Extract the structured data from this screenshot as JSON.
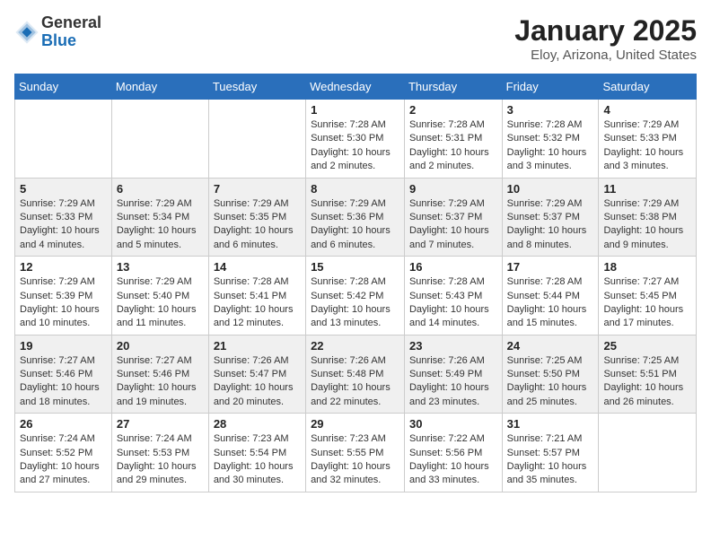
{
  "logo": {
    "general": "General",
    "blue": "Blue"
  },
  "title": "January 2025",
  "subtitle": "Eloy, Arizona, United States",
  "headers": [
    "Sunday",
    "Monday",
    "Tuesday",
    "Wednesday",
    "Thursday",
    "Friday",
    "Saturday"
  ],
  "weeks": [
    [
      {
        "num": "",
        "info": ""
      },
      {
        "num": "",
        "info": ""
      },
      {
        "num": "",
        "info": ""
      },
      {
        "num": "1",
        "info": "Sunrise: 7:28 AM\nSunset: 5:30 PM\nDaylight: 10 hours\nand 2 minutes."
      },
      {
        "num": "2",
        "info": "Sunrise: 7:28 AM\nSunset: 5:31 PM\nDaylight: 10 hours\nand 2 minutes."
      },
      {
        "num": "3",
        "info": "Sunrise: 7:28 AM\nSunset: 5:32 PM\nDaylight: 10 hours\nand 3 minutes."
      },
      {
        "num": "4",
        "info": "Sunrise: 7:29 AM\nSunset: 5:33 PM\nDaylight: 10 hours\nand 3 minutes."
      }
    ],
    [
      {
        "num": "5",
        "info": "Sunrise: 7:29 AM\nSunset: 5:33 PM\nDaylight: 10 hours\nand 4 minutes."
      },
      {
        "num": "6",
        "info": "Sunrise: 7:29 AM\nSunset: 5:34 PM\nDaylight: 10 hours\nand 5 minutes."
      },
      {
        "num": "7",
        "info": "Sunrise: 7:29 AM\nSunset: 5:35 PM\nDaylight: 10 hours\nand 6 minutes."
      },
      {
        "num": "8",
        "info": "Sunrise: 7:29 AM\nSunset: 5:36 PM\nDaylight: 10 hours\nand 6 minutes."
      },
      {
        "num": "9",
        "info": "Sunrise: 7:29 AM\nSunset: 5:37 PM\nDaylight: 10 hours\nand 7 minutes."
      },
      {
        "num": "10",
        "info": "Sunrise: 7:29 AM\nSunset: 5:37 PM\nDaylight: 10 hours\nand 8 minutes."
      },
      {
        "num": "11",
        "info": "Sunrise: 7:29 AM\nSunset: 5:38 PM\nDaylight: 10 hours\nand 9 minutes."
      }
    ],
    [
      {
        "num": "12",
        "info": "Sunrise: 7:29 AM\nSunset: 5:39 PM\nDaylight: 10 hours\nand 10 minutes."
      },
      {
        "num": "13",
        "info": "Sunrise: 7:29 AM\nSunset: 5:40 PM\nDaylight: 10 hours\nand 11 minutes."
      },
      {
        "num": "14",
        "info": "Sunrise: 7:28 AM\nSunset: 5:41 PM\nDaylight: 10 hours\nand 12 minutes."
      },
      {
        "num": "15",
        "info": "Sunrise: 7:28 AM\nSunset: 5:42 PM\nDaylight: 10 hours\nand 13 minutes."
      },
      {
        "num": "16",
        "info": "Sunrise: 7:28 AM\nSunset: 5:43 PM\nDaylight: 10 hours\nand 14 minutes."
      },
      {
        "num": "17",
        "info": "Sunrise: 7:28 AM\nSunset: 5:44 PM\nDaylight: 10 hours\nand 15 minutes."
      },
      {
        "num": "18",
        "info": "Sunrise: 7:27 AM\nSunset: 5:45 PM\nDaylight: 10 hours\nand 17 minutes."
      }
    ],
    [
      {
        "num": "19",
        "info": "Sunrise: 7:27 AM\nSunset: 5:46 PM\nDaylight: 10 hours\nand 18 minutes."
      },
      {
        "num": "20",
        "info": "Sunrise: 7:27 AM\nSunset: 5:46 PM\nDaylight: 10 hours\nand 19 minutes."
      },
      {
        "num": "21",
        "info": "Sunrise: 7:26 AM\nSunset: 5:47 PM\nDaylight: 10 hours\nand 20 minutes."
      },
      {
        "num": "22",
        "info": "Sunrise: 7:26 AM\nSunset: 5:48 PM\nDaylight: 10 hours\nand 22 minutes."
      },
      {
        "num": "23",
        "info": "Sunrise: 7:26 AM\nSunset: 5:49 PM\nDaylight: 10 hours\nand 23 minutes."
      },
      {
        "num": "24",
        "info": "Sunrise: 7:25 AM\nSunset: 5:50 PM\nDaylight: 10 hours\nand 25 minutes."
      },
      {
        "num": "25",
        "info": "Sunrise: 7:25 AM\nSunset: 5:51 PM\nDaylight: 10 hours\nand 26 minutes."
      }
    ],
    [
      {
        "num": "26",
        "info": "Sunrise: 7:24 AM\nSunset: 5:52 PM\nDaylight: 10 hours\nand 27 minutes."
      },
      {
        "num": "27",
        "info": "Sunrise: 7:24 AM\nSunset: 5:53 PM\nDaylight: 10 hours\nand 29 minutes."
      },
      {
        "num": "28",
        "info": "Sunrise: 7:23 AM\nSunset: 5:54 PM\nDaylight: 10 hours\nand 30 minutes."
      },
      {
        "num": "29",
        "info": "Sunrise: 7:23 AM\nSunset: 5:55 PM\nDaylight: 10 hours\nand 32 minutes."
      },
      {
        "num": "30",
        "info": "Sunrise: 7:22 AM\nSunset: 5:56 PM\nDaylight: 10 hours\nand 33 minutes."
      },
      {
        "num": "31",
        "info": "Sunrise: 7:21 AM\nSunset: 5:57 PM\nDaylight: 10 hours\nand 35 minutes."
      },
      {
        "num": "",
        "info": ""
      }
    ]
  ]
}
